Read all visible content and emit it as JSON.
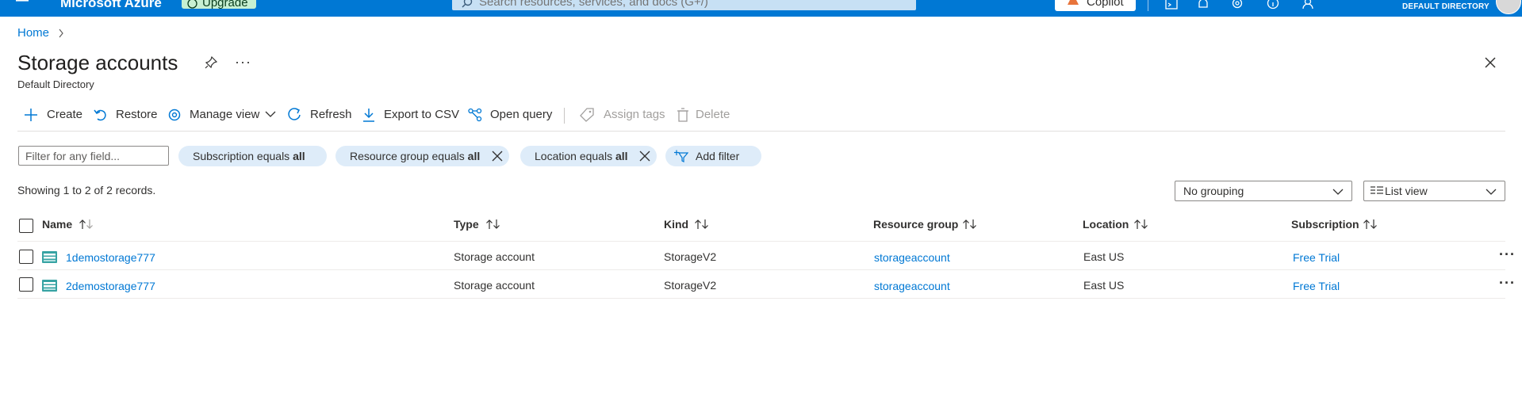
{
  "topbar": {
    "brand": "Microsoft Azure",
    "upgrade_label": "Upgrade",
    "search_placeholder": "Search resources, services, and docs (G+/)",
    "copilot_label": "Copilot",
    "directory_label": "DEFAULT DIRECTORY"
  },
  "breadcrumb": {
    "home": "Home"
  },
  "header": {
    "title": "Storage accounts",
    "subtitle": "Default Directory"
  },
  "commands": {
    "create": "Create",
    "restore": "Restore",
    "manage_view": "Manage view",
    "refresh": "Refresh",
    "export_csv": "Export to CSV",
    "open_query": "Open query",
    "assign_tags": "Assign tags",
    "delete": "Delete"
  },
  "filters": {
    "placeholder": "Filter for any field...",
    "subscription_prefix": "Subscription equals ",
    "subscription_value": "all",
    "resource_group_prefix": "Resource group equals ",
    "resource_group_value": "all",
    "location_prefix": "Location equals ",
    "location_value": "all",
    "add_filter": "Add filter"
  },
  "records_text": "Showing 1 to 2 of 2 records.",
  "grouping": {
    "selected": "No grouping"
  },
  "view_mode": {
    "selected": "List view"
  },
  "table": {
    "columns": [
      "Name",
      "Type",
      "Kind",
      "Resource group",
      "Location",
      "Subscription"
    ],
    "rows": [
      {
        "name": "1demostorage777",
        "type": "Storage account",
        "kind": "StorageV2",
        "resource_group": "storageaccount",
        "location": "East US",
        "subscription": "Free Trial"
      },
      {
        "name": "2demostorage777",
        "type": "Storage account",
        "kind": "StorageV2",
        "resource_group": "storageaccount",
        "location": "East US",
        "subscription": "Free Trial"
      }
    ],
    "row_more": "···"
  },
  "colors": {
    "topbar_bg": "#0078d4",
    "link": "#0078d4",
    "pill_bg": "#deecf9",
    "upgrade_bg": "#c7f0d2",
    "storage_icon": "#37a3a3"
  },
  "icons": [
    "hamburger-icon",
    "upgrade-icon",
    "search-icon",
    "copilot-icon",
    "cloud-shell-icon",
    "notifications-icon",
    "settings-icon",
    "help-icon",
    "feedback-icon",
    "pin-icon",
    "close-icon",
    "add-icon",
    "restore-icon",
    "manage-view-icon",
    "refresh-icon",
    "export-icon",
    "query-icon",
    "tag-icon",
    "delete-icon",
    "add-filter-icon",
    "storage-account-icon"
  ]
}
